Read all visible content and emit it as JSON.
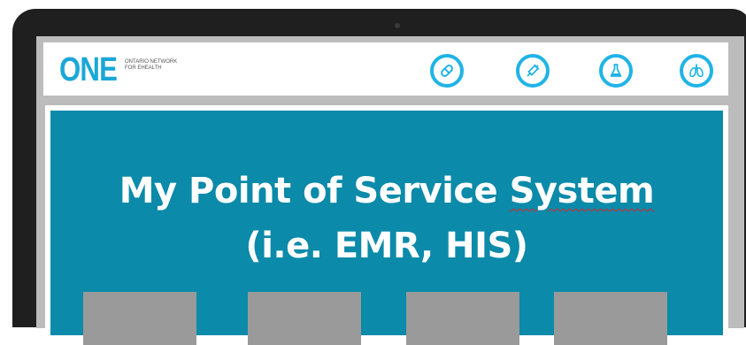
{
  "header": {
    "logo_text": "ONE",
    "logo_tagline_line1": "ONTARIO NETWORK",
    "logo_tagline_line2": "FOR EHEALTH",
    "icons": [
      "pill-icon",
      "syringe-icon",
      "flask-icon",
      "lungs-icon"
    ]
  },
  "main": {
    "title_line1_prefix": "My Point of Service ",
    "title_line1_word": "System",
    "title_line2": "(i.e. EMR, HIS)"
  },
  "colors": {
    "accent": "#20b4e6",
    "panel": "#0b8aa9",
    "tile": "#9a9a9a",
    "bezel": "#1f1f1f"
  }
}
